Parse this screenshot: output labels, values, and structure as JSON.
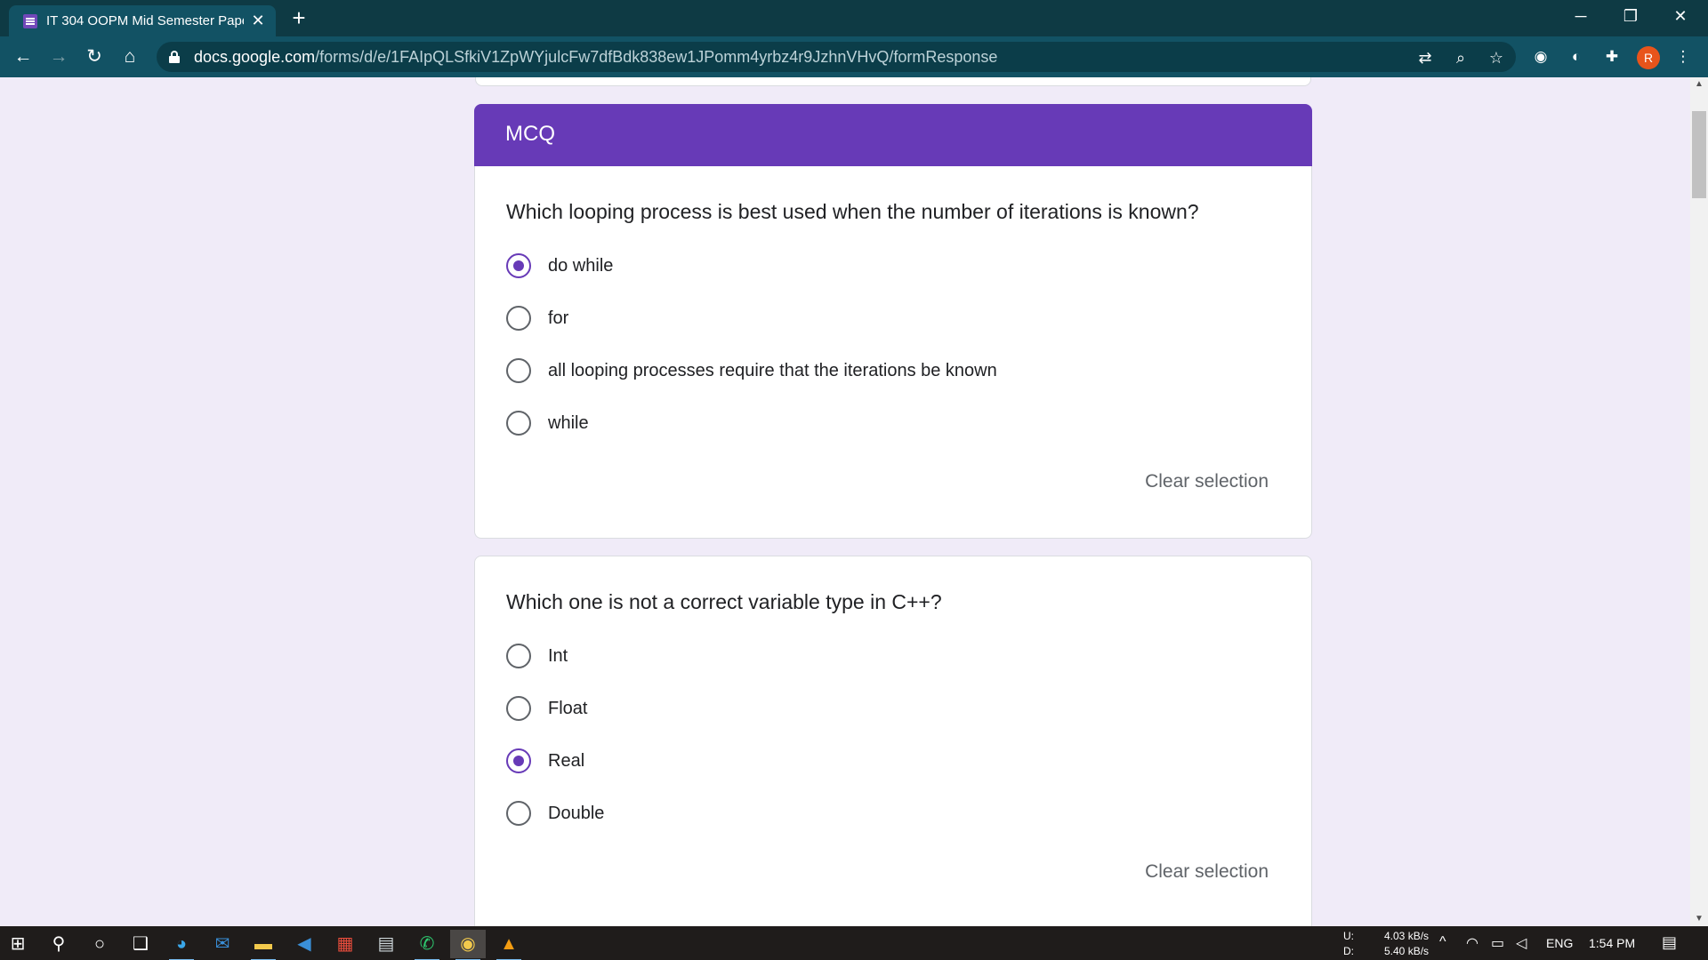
{
  "browser": {
    "tab_title": "IT 304 OOPM Mid Semester Paper",
    "tab_close_icon": "✕",
    "new_tab_icon": "+",
    "url_host": "docs.google.com",
    "url_path": "/forms/d/e/1FAIpQLSfkiV1ZpWYjulcFw7dfBdk838ew1JPomm4yrbz4r9JzhnVHvQ/formResponse",
    "profile_initial": "R",
    "window_controls": {
      "minimize": "─",
      "restore": "❐",
      "close": "✕"
    }
  },
  "form": {
    "section_title": "MCQ",
    "questions": [
      {
        "text": "Which looping process is best used when the number of iterations is known?",
        "options": [
          {
            "label": "do while",
            "selected": true
          },
          {
            "label": "for",
            "selected": false
          },
          {
            "label": "all looping processes require that the iterations be known",
            "selected": false
          },
          {
            "label": "while",
            "selected": false
          }
        ],
        "clear_label": "Clear selection"
      },
      {
        "text": "Which one is not a correct variable type in C++?",
        "options": [
          {
            "label": "Int",
            "selected": false
          },
          {
            "label": "Float",
            "selected": false
          },
          {
            "label": "Real",
            "selected": true
          },
          {
            "label": "Double",
            "selected": false
          }
        ],
        "clear_label": "Clear selection"
      }
    ],
    "feedback_icon": "!"
  },
  "taskbar": {
    "net_upload_label": "U:",
    "net_download_label": "D:",
    "net_upload": "4.03 kB/s",
    "net_download": "5.40 kB/s",
    "language": "ENG",
    "time": "1:54 PM"
  },
  "colors": {
    "accent": "#673ab7",
    "page_background": "#f0ebf8",
    "browser_frame": "#0e3a44",
    "browser_toolbar": "#125264"
  }
}
